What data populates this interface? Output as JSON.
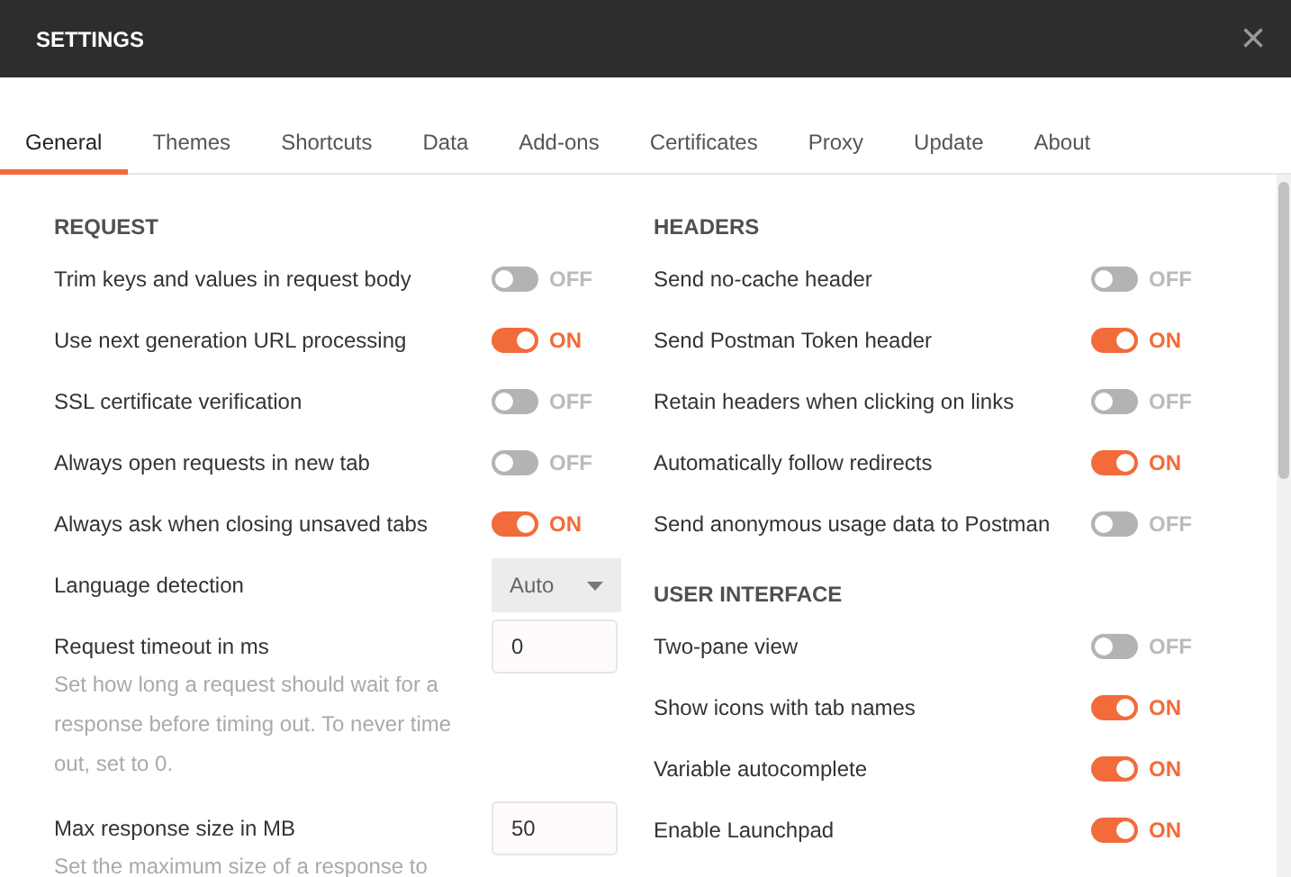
{
  "window": {
    "title": "SETTINGS",
    "close": "×"
  },
  "tabs": [
    {
      "label": "General",
      "selected": true
    },
    {
      "label": "Themes",
      "selected": false
    },
    {
      "label": "Shortcuts",
      "selected": false
    },
    {
      "label": "Data",
      "selected": false
    },
    {
      "label": "Add-ons",
      "selected": false
    },
    {
      "label": "Certificates",
      "selected": false
    },
    {
      "label": "Proxy",
      "selected": false
    },
    {
      "label": "Update",
      "selected": false
    },
    {
      "label": "About",
      "selected": false
    }
  ],
  "columns": [
    {
      "sections": [
        {
          "heading": "REQUEST",
          "settings": [
            {
              "kind": "toggle",
              "label": "Trim keys and values in request body",
              "on": false,
              "state_text": "OFF"
            },
            {
              "kind": "toggle",
              "label": "Use next generation URL processing",
              "on": true,
              "state_text": "ON"
            },
            {
              "kind": "toggle",
              "label": "SSL certificate verification",
              "on": false,
              "state_text": "OFF"
            },
            {
              "kind": "toggle",
              "label": "Always open requests in new tab",
              "on": false,
              "state_text": "OFF"
            },
            {
              "kind": "toggle",
              "label": "Always ask when closing unsaved tabs",
              "on": true,
              "state_text": "ON"
            },
            {
              "kind": "select",
              "label": "Language detection",
              "value": "Auto"
            },
            {
              "kind": "number",
              "label": "Request timeout in ms",
              "value": "0",
              "description": "Set how long a request should wait for a response before timing out. To never time out, set to 0."
            },
            {
              "kind": "number",
              "label": "Max response size in MB",
              "value": "50",
              "description": "Set the maximum size of a response to"
            }
          ]
        }
      ]
    },
    {
      "sections": [
        {
          "heading": "HEADERS",
          "settings": [
            {
              "kind": "toggle",
              "label": "Send no-cache header",
              "on": false,
              "state_text": "OFF"
            },
            {
              "kind": "toggle",
              "label": "Send Postman Token header",
              "on": true,
              "state_text": "ON"
            },
            {
              "kind": "toggle",
              "label": "Retain headers when clicking on links",
              "on": false,
              "state_text": "OFF"
            },
            {
              "kind": "toggle",
              "label": "Automatically follow redirects",
              "on": true,
              "state_text": "ON"
            },
            {
              "kind": "toggle",
              "label": "Send anonymous usage data to Postman",
              "on": false,
              "state_text": "OFF"
            }
          ]
        },
        {
          "heading": "USER INTERFACE",
          "settings": [
            {
              "kind": "toggle",
              "label": "Two-pane view",
              "on": false,
              "state_text": "OFF"
            },
            {
              "kind": "toggle",
              "label": "Show icons with tab names",
              "on": true,
              "state_text": "ON"
            },
            {
              "kind": "toggle",
              "label": "Variable autocomplete",
              "on": true,
              "state_text": "ON"
            },
            {
              "kind": "toggle",
              "label": "Enable Launchpad",
              "on": true,
              "state_text": "ON"
            }
          ]
        }
      ]
    }
  ]
}
